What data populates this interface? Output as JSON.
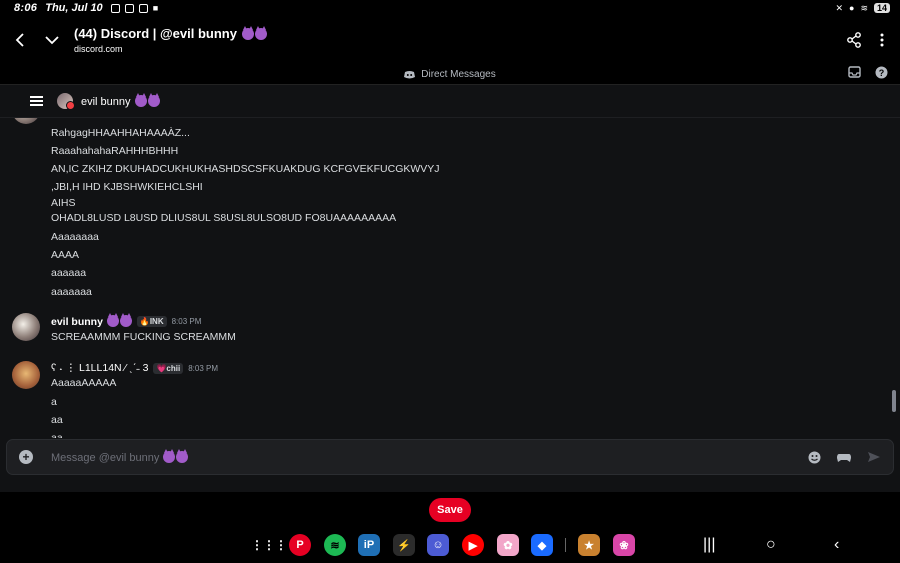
{
  "status_bar": {
    "time": "8:06",
    "date": "Thu, Jul 10",
    "battery": "14"
  },
  "browser": {
    "page_title": "(44) Discord | @evil bunny",
    "url": "discord.com",
    "back_icon": "chevron-left-icon",
    "dropdown_icon": "chevron-down-icon",
    "share_icon": "share-icon",
    "menu_icon": "more-vertical-icon"
  },
  "discord": {
    "section_label": "Direct Messages",
    "channel_name": "evil bunny",
    "messages_top": [
      "RahgagHHAAHHAHAAAÀZ...",
      "RaaahahahaRAHHHBHHH",
      "AN,IC ZKIHZ DKUHADCUKHUKHASHDSCSFKUAKDUG KCFGVEKFUCGKWVYJ",
      ",JBI,H IHD KJBSHWKIEHCLSHI",
      "AIHS",
      "OHADL8LUSD L8USD DLIUS8UL S8USL8ULSO8UD FO8UAAAAAAAAA",
      "Aaaaaaaa",
      "AAAA",
      "aaaaaa",
      "aaaaaaa"
    ],
    "msg_group_1": {
      "author": "evil bunny",
      "tag": "🔥INK",
      "time": "8:03 PM",
      "lines": [
        "SCREAAMMM FUCKING SCREAMMM"
      ]
    },
    "msg_group_2": {
      "author": "ʕ ˖ ⋮ L1LL14N ⁄ ˎˊ˗ 3",
      "tag": "💗chii",
      "time": "8:03 PM",
      "lines": [
        "AaaaaAAAAA",
        "a",
        "aa",
        "aa"
      ]
    },
    "composer_placeholder": "Message @evil bunny"
  },
  "save_button": "Save",
  "taskbar_apps": [
    "Pinterest",
    "Spotify",
    "ibisPaint",
    "Lightning",
    "Gacha",
    "YouTube Music",
    "Anime",
    "Roblox",
    "Game",
    "Blossom"
  ]
}
